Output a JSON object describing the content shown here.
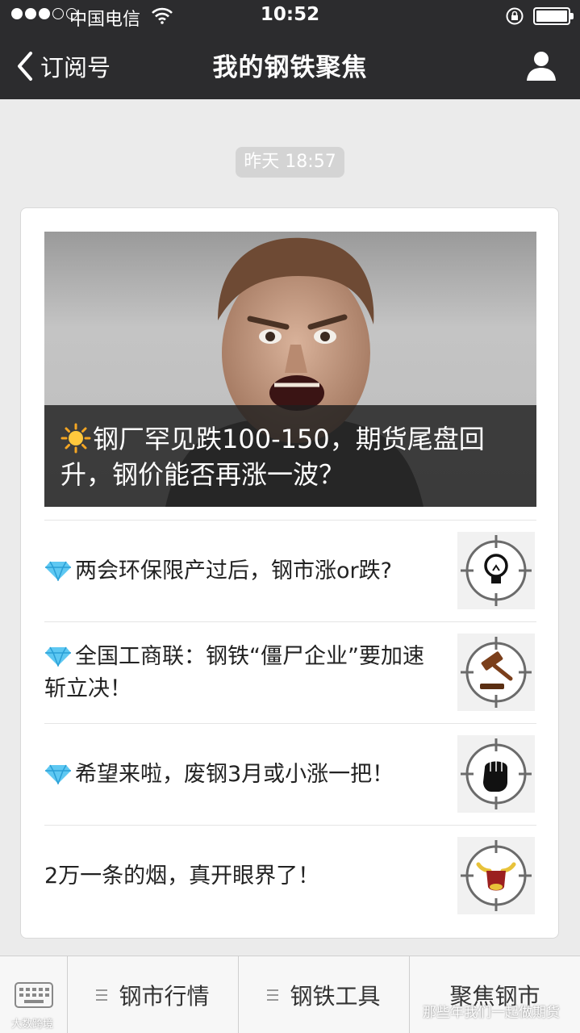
{
  "status_bar": {
    "carrier": "中国电信",
    "time": "10:52",
    "signal_strength": 3,
    "battery_level": 1.0
  },
  "nav": {
    "back_label": "订阅号",
    "title": "我的钢铁聚焦",
    "back_icon": "chevron-left-icon",
    "profile_icon": "person-icon"
  },
  "timestamp": "昨天 18:57",
  "article": {
    "cover": {
      "title": "钢厂罕见跌100-150，期货尾盘回升，钢价能否再涨一波？",
      "icon": "sun-emoji"
    },
    "items": [
      {
        "title": "两会环保限产过后，钢市涨or跌?",
        "icon": "diamond-emoji",
        "thumb": "lightbulb-crosshair"
      },
      {
        "title": "全国工商联：钢铁“僵尸企业”要加速斩立决！",
        "icon": "diamond-emoji",
        "thumb": "gavel-crosshair"
      },
      {
        "title": "希望来啦，废钢3月或小涨一把！",
        "icon": "diamond-emoji",
        "thumb": "fist-crosshair"
      },
      {
        "title": "2万一条的烟，真开眼界了！",
        "icon": "",
        "thumb": "bull-crosshair"
      }
    ]
  },
  "bottom_menu": {
    "keyboard_icon": "keyboard-icon",
    "items": [
      "钢市行情",
      "钢铁工具",
      "聚焦钢市"
    ]
  },
  "watermark": "那些年我们一起做期货",
  "watermark2": "大数跨境",
  "colors": {
    "nav_bg": "#2c2c2e",
    "page_bg": "#ebebeb",
    "timestamp_bg": "#d4d4d4"
  }
}
